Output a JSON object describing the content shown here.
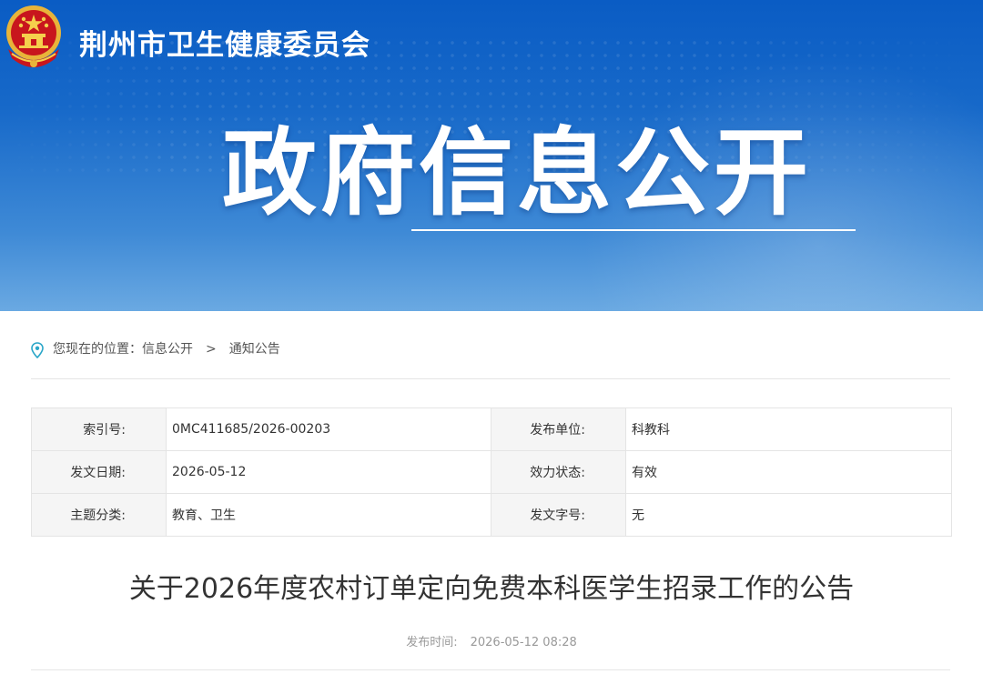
{
  "header": {
    "site_title": "荆州市卫生健康委员会",
    "banner_title": "政府信息公开",
    "emblem_icon": "national-emblem-icon"
  },
  "breadcrumb": {
    "prefix": "您现在的位置：",
    "items": [
      "信息公开",
      "通知公告"
    ],
    "separator": ">",
    "icon": "location-pin-icon"
  },
  "meta": {
    "rows": [
      {
        "k1": "索引号:",
        "v1": "0MC411685/2026-00203",
        "k2": "发布单位:",
        "v2": "科教科"
      },
      {
        "k1": "发文日期:",
        "v1": "2026-05-12",
        "k2": "效力状态:",
        "v2": "有效"
      },
      {
        "k1": "主题分类:",
        "v1": "教育、卫生",
        "k2": "发文字号:",
        "v2": "无"
      }
    ]
  },
  "article": {
    "title": "关于2026年度农村订单定向免费本科医学生招录工作的公告",
    "publish_label": "发布时间:",
    "publish_time": "2026-05-12 08:28"
  },
  "colors": {
    "banner_top": "#0a5cc4",
    "banner_bottom": "#6aa9e2",
    "pin_accent": "#2aa6c8"
  }
}
